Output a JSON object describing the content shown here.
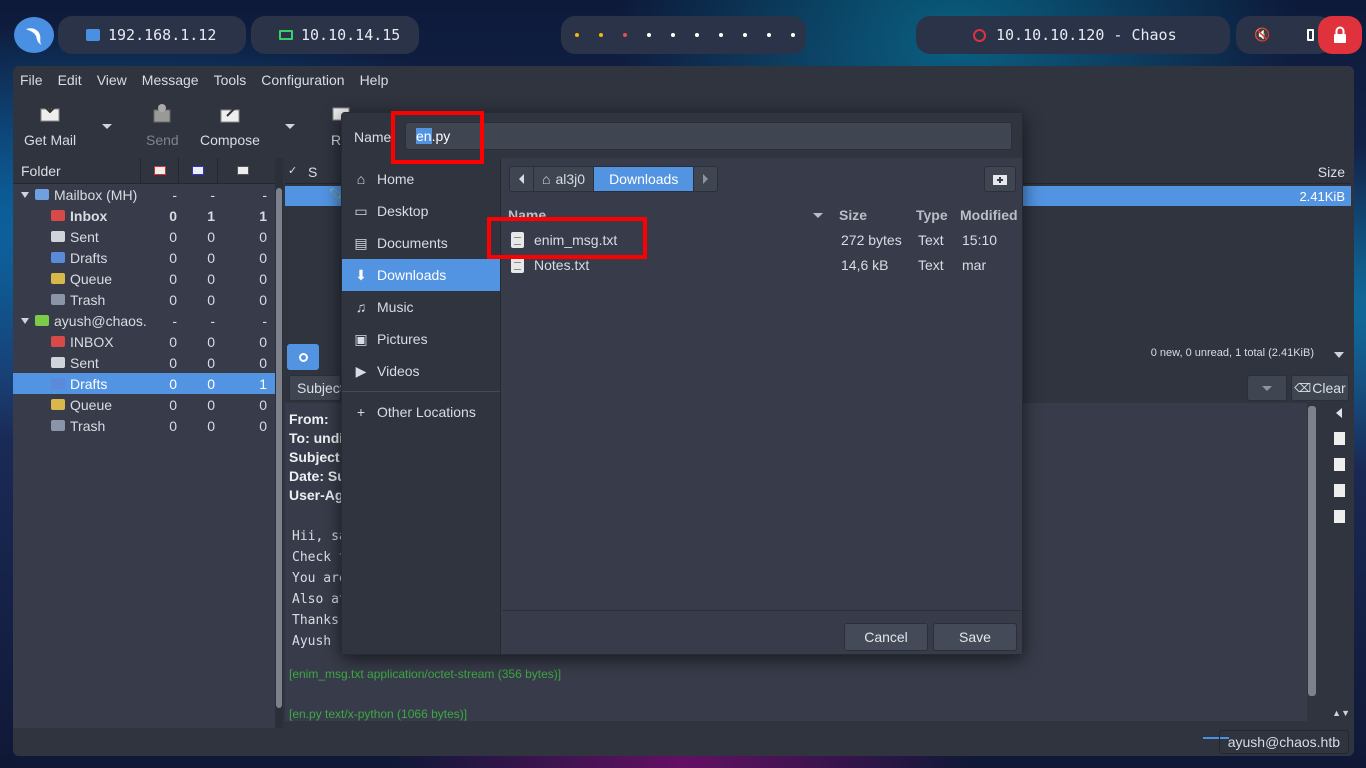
{
  "panel": {
    "ip1": "192.168.1.12",
    "ip2": "10.10.14.15",
    "target": "10.10.10.120 - Chaos",
    "logo_icon": "kali-dragon-icon",
    "colors": {
      "accent": "#5294e2",
      "lock": "#e0323c",
      "red_box": "#ff0000"
    }
  },
  "menu": [
    "File",
    "Edit",
    "View",
    "Message",
    "Tools",
    "Configuration",
    "Help"
  ],
  "toolbar": {
    "get_mail": "Get Mail",
    "send": "Send",
    "compose": "Compose",
    "reply_partial": "Re"
  },
  "folders": {
    "header": "Folder",
    "rows": [
      {
        "name": "Mailbox (MH)",
        "c1": "-",
        "c2": "-",
        "c3": "-",
        "level": 0
      },
      {
        "name": "Inbox",
        "c1": "0",
        "c2": "1",
        "c3": "1",
        "level": 1,
        "bold": true
      },
      {
        "name": "Sent",
        "c1": "0",
        "c2": "0",
        "c3": "0",
        "level": 1
      },
      {
        "name": "Drafts",
        "c1": "0",
        "c2": "0",
        "c3": "0",
        "level": 1
      },
      {
        "name": "Queue",
        "c1": "0",
        "c2": "0",
        "c3": "0",
        "level": 1
      },
      {
        "name": "Trash",
        "c1": "0",
        "c2": "0",
        "c3": "0",
        "level": 1
      },
      {
        "name": "ayush@chaos.",
        "c1": "-",
        "c2": "-",
        "c3": "-",
        "level": 0
      },
      {
        "name": "INBOX",
        "c1": "0",
        "c2": "0",
        "c3": "0",
        "level": 1
      },
      {
        "name": "Sent",
        "c1": "0",
        "c2": "0",
        "c3": "0",
        "level": 1
      },
      {
        "name": "Drafts",
        "c1": "0",
        "c2": "0",
        "c3": "1",
        "level": 1,
        "selected": true
      },
      {
        "name": "Queue",
        "c1": "0",
        "c2": "0",
        "c3": "0",
        "level": 1
      },
      {
        "name": "Trash",
        "c1": "0",
        "c2": "0",
        "c3": "0",
        "level": 1
      }
    ]
  },
  "message_list": {
    "col_s": "S",
    "col_size": "Size",
    "selected_size": "2.41KiB",
    "status": "0 new, 0 unread, 1 total (2.41KiB)"
  },
  "quick_search": {
    "field": "Subject",
    "clear": "Clear"
  },
  "message_view": {
    "headers": [
      "From:",
      "To: undis",
      "Subject:",
      "Date: Su",
      "User-Age"
    ],
    "body": [
      "Hii, sa",
      "Check t",
      "You are",
      "Also at",
      "Thanks",
      "Ayush"
    ],
    "attachment1": "[enim_msg.txt  application/octet-stream (356 bytes)]",
    "attachment2": "[en.py  text/x-python (1066 bytes)]"
  },
  "status_bar": {
    "account": "ayush@chaos.htb"
  },
  "dialog": {
    "name_label": "Name:",
    "filename_highlight": "en",
    "filename_rest": ".py",
    "places": [
      {
        "label": "Home",
        "icon": "home-icon"
      },
      {
        "label": "Desktop",
        "icon": "desktop-icon"
      },
      {
        "label": "Documents",
        "icon": "documents-icon"
      },
      {
        "label": "Downloads",
        "icon": "download-icon",
        "selected": true
      },
      {
        "label": "Music",
        "icon": "music-icon"
      },
      {
        "label": "Pictures",
        "icon": "pictures-icon"
      },
      {
        "label": "Videos",
        "icon": "videos-icon"
      },
      {
        "label": "Other Locations",
        "icon": "plus-icon"
      }
    ],
    "path": {
      "home": "al3j0",
      "current": "Downloads"
    },
    "columns": {
      "name": "Name",
      "size": "Size",
      "type": "Type",
      "modified": "Modified"
    },
    "files": [
      {
        "name": "enim_msg.txt",
        "size": "272 bytes",
        "type": "Text",
        "modified": "15:10"
      },
      {
        "name": "Notes.txt",
        "size": "14,6 kB",
        "type": "Text",
        "modified": "mar"
      }
    ],
    "cancel": "Cancel",
    "save": "Save"
  }
}
